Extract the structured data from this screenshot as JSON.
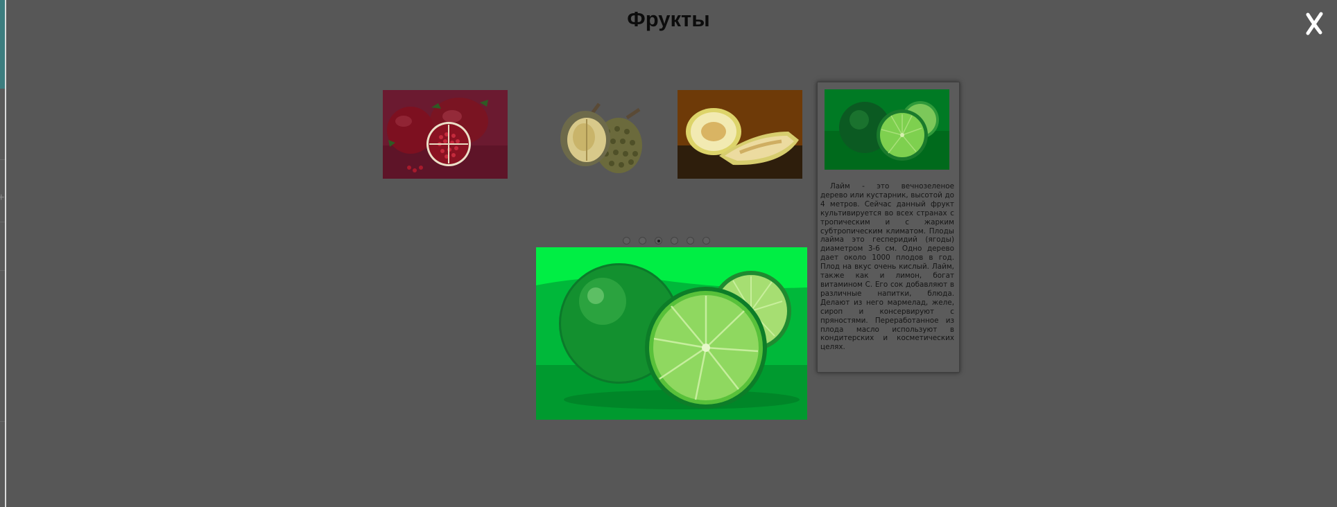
{
  "modal": {
    "title": "Фрукты",
    "close_label": "✗"
  },
  "thumbnails": [
    {
      "fruit": "pomegranate",
      "icon": "pomegranate-image"
    },
    {
      "fruit": "durian",
      "icon": "durian-image"
    },
    {
      "fruit": "melon",
      "icon": "melon-image"
    }
  ],
  "info_card": {
    "fruit": "lime",
    "icon": "lime-image",
    "description": "Лайм - это вечнозеленое дерево или кустарник, высотой до 4 метров. Сейчас данный фрукт культивируется во всех странах с тропическим и с жарким субтропическим климатом. Плоды лайма это гесперидий (ягоды) диаметром 3-6 см. Одно дерево дает около 1000 плодов в год. Плод на вкус очень кислый. Лайм, также как и лимон, богат витамином С. Его сок добавляют в различные напитки, блюда. Делают из него мармелад, желе, сироп и консервируют с пряностями. Переработанное из плода масло используют в кондитерских и косметических целях."
  },
  "carousel": {
    "slide_count": 6,
    "active_index": 3
  },
  "main_image": {
    "fruit": "lime",
    "icon": "lime-large-image"
  },
  "colors": {
    "overlay": "#575757",
    "lime_background": "#00ee44"
  }
}
